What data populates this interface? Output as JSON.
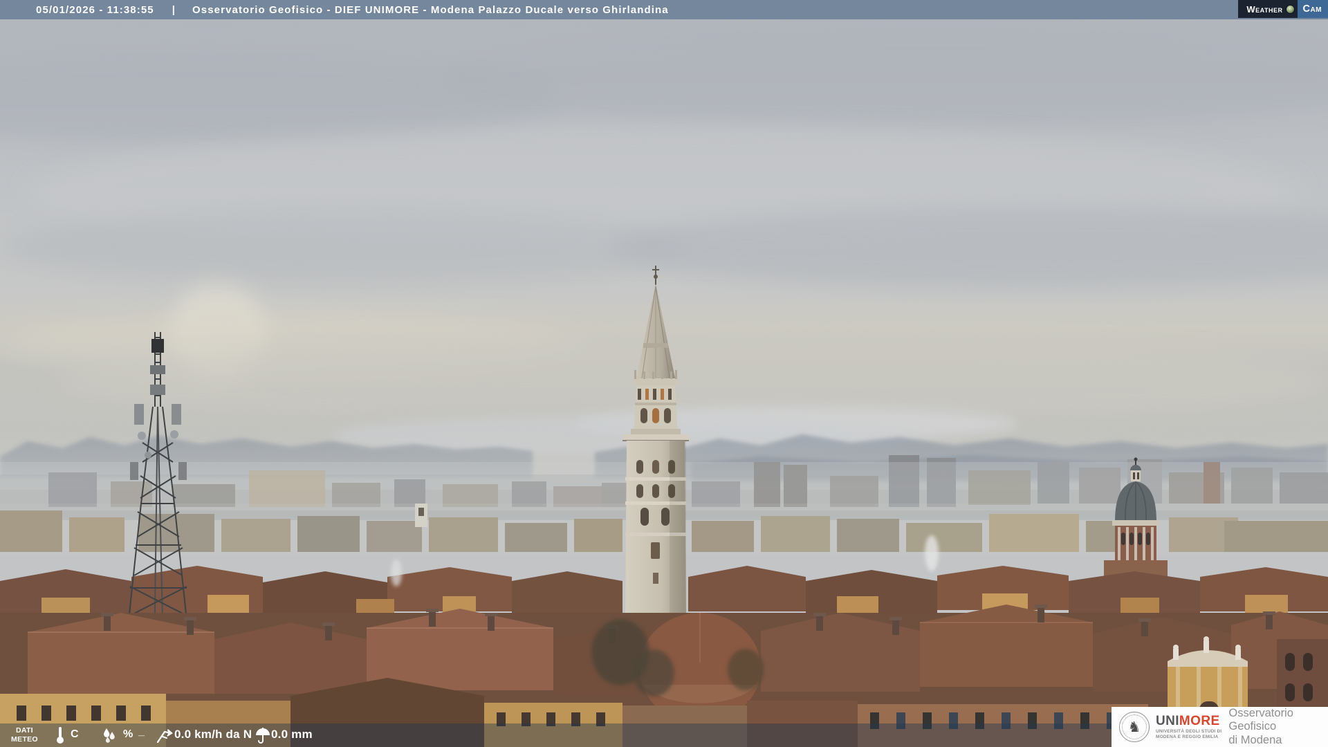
{
  "header": {
    "timestamp": "05/01/2026 - 11:38:55",
    "separator": "|",
    "title": "Osservatorio Geofisico - DIEF UNIMORE - Modena Palazzo Ducale verso Ghirlandina",
    "bg_color": "#75879C",
    "text_color": "#FFFFFF"
  },
  "watermark": {
    "part1": "Weather",
    "part2": "Cam",
    "dark_bg": "#1C2330",
    "blue_bg": "#3E6895"
  },
  "meteo_bar": {
    "label_line1": "DATI",
    "label_line2": "METEO",
    "temperature_unit": "C",
    "humidity_unit": "%",
    "humidity_value": "_",
    "wind_value": "0.0 km/h da N",
    "precipitation_value": "0.0 mm",
    "icons": [
      "thermometer-icon",
      "humidity-drops-icon",
      "wind-vane-icon",
      "umbrella-icon"
    ],
    "overlay_color": "rgba(33,56,78,0.42)"
  },
  "branding": {
    "acronym_gray": "UNI",
    "acronym_red": "MORE",
    "university_line1": "Università degli Studi di",
    "university_line2": "Modena e Reggio Emilia",
    "observatory_line1": "Osservatorio Geofisico",
    "observatory_line2": "di Modena",
    "accent_red": "#D9452C",
    "seal_icon": "unimore-seal-icon"
  },
  "scene_colors": {
    "sky_top": "#B5BAC0",
    "sky_horizon_warm": "#CFCCC2",
    "mountains": "#7E8998",
    "distant_city": "#9AA0A4",
    "rooftops": "#7B523E",
    "tower_stone": "#D2CBBB",
    "dome_lead": "#5F666A"
  }
}
